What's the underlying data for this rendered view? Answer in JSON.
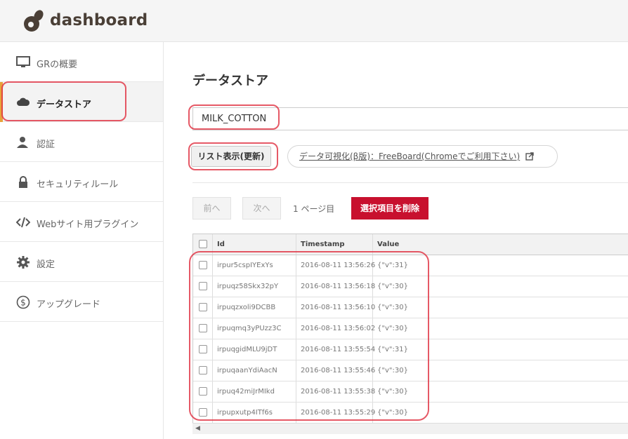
{
  "header": {
    "logo_text": "dashboard"
  },
  "sidebar": {
    "items": [
      {
        "label": "GRの概要",
        "icon": "monitor-icon"
      },
      {
        "label": "データストア",
        "icon": "cloud-icon"
      },
      {
        "label": "認証",
        "icon": "user-icon"
      },
      {
        "label": "セキュリティルール",
        "icon": "lock-icon"
      },
      {
        "label": "Webサイト用プラグイン",
        "icon": "code-icon"
      },
      {
        "label": "設定",
        "icon": "gear-icon"
      },
      {
        "label": "アップグレード",
        "icon": "dollar-icon"
      }
    ],
    "active_index": 1
  },
  "main": {
    "title": "データストア",
    "store_name": "MILK_COTTON",
    "list_button": "リスト表示(更新)",
    "visualize_link": "データ可視化(β版)：FreeBoard(Chromeでご利用下さい)",
    "prev_button": "前へ",
    "next_button": "次へ",
    "page_label": "1 ページ目",
    "delete_button": "選択項目を削除",
    "table": {
      "columns": [
        "Id",
        "Timestamp",
        "Value"
      ],
      "rows": [
        [
          "irpur5cspIYExYs",
          "2016-08-11 13:56:26",
          "{\"v\":31}"
        ],
        [
          "irpuqz58Skx32pY",
          "2016-08-11 13:56:18",
          "{\"v\":30}"
        ],
        [
          "irpuqzxoli9DCBB",
          "2016-08-11 13:56:10",
          "{\"v\":30}"
        ],
        [
          "irpuqmq3yPUzz3C",
          "2016-08-11 13:56:02",
          "{\"v\":30}"
        ],
        [
          "irpuqgidMLU9jDT",
          "2016-08-11 13:55:54",
          "{\"v\":31}"
        ],
        [
          "irpuqaanYdiAacN",
          "2016-08-11 13:55:46",
          "{\"v\":30}"
        ],
        [
          "irpuq42miJrMIkd",
          "2016-08-11 13:55:38",
          "{\"v\":30}"
        ],
        [
          "irpupxutp4ITf6s",
          "2016-08-11 13:55:29",
          "{\"v\":30}"
        ]
      ]
    }
  },
  "colors": {
    "accent": "#e8a33a",
    "danger": "#c8102e",
    "annotation": "#e03040"
  }
}
